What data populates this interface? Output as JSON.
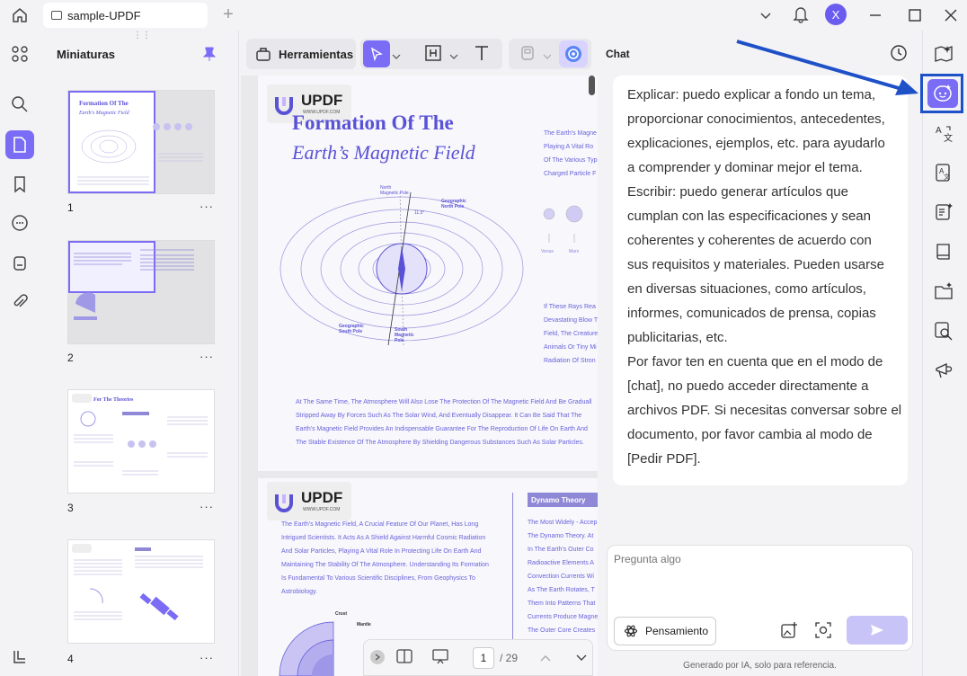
{
  "window": {
    "tab_title": "sample-UPDF",
    "avatar_letter": "X"
  },
  "sidebar": {
    "title": "Miniaturas",
    "pages": [
      "1",
      "2",
      "3",
      "4"
    ],
    "more_label": "···"
  },
  "toolbar": {
    "tools_label": "Herramientas"
  },
  "document": {
    "logo_text": "UPDF",
    "logo_sub": "WWW.UPDF.COM",
    "title_line1": "Formation Of The",
    "title_line2": "Earth’s Magnetic Field",
    "diagram_labels": {
      "north": "North\nMagnetic Pole",
      "geo_north": "Geographic\nNorth Pole",
      "geo_south": "Geographic\nSouth Pole",
      "south": "South\nMagnetic\nPole",
      "angle": "11.5°",
      "venus": "Venus",
      "mars": "Mars"
    },
    "side_text_1": "The Earth's Magne\nPlaying A Vital Ro\nOf The Various Typ\nCharged Particle F",
    "side_text_2": "If These Rays Rea\nDevastating Blow T\nField, The Creature\nAnimals Or Tiny Mi\nRadiation Of Stron",
    "body_text": "At The Same Time, The Atmosphere Will Also Lose The Protection Of The Magnetic Field And Be Graduall\nStripped Away By Forces Such As The Solar Wind, And Eventually Disappear. It Can Be Said That The\nEarth's Magnetic Field Provides An Indispensable Guarantee For The Reproduction Of Life On Earth And\nThe Stable Existence Of The Atmosphere By Shielding Dangerous Substances Such As Solar Particles.",
    "page2_text": "The Earth's Magnetic Field, A Crucial Feature Of Our Planet, Has Long\nIntrigued Scientists. It Acts As A Shield Against Harmful Cosmic Radiation\nAnd Solar Particles, Playing A Vital Role In Protecting Life On Earth And\nMaintaining The Stability Of The Atmosphere. Understanding Its Formation\nIs Fundamental To Various Scientific Disciplines, From Geophysics To\nAstrobiology.",
    "dynamo_title": "Dynamo Theory",
    "dynamo_text": "The Most Widely - Accep\nThe Dynamo Theory. At\nIn The Earth's Outer Co\nRadioactive Elements A\nConvection Currents Wi\nAs The Earth Rotates, T\nThem Into Patterns That\nCurrents Produce Magne\nThe Outer Core Creates",
    "crust_label": "Crust",
    "mantle_label": "Mantle",
    "page_current": "1",
    "page_total": "/ 29"
  },
  "chat": {
    "header": "Chat",
    "message": "Explicar: puedo explicar a fondo un tema,\nproporcionar conocimientos, antecedentes,\nexplicaciones, ejemplos, etc. para ayudarlo\na comprender y dominar mejor el tema.\nEscribir: puedo generar artículos que\ncumplan con las especificaciones y sean\ncoherentes y coherentes de acuerdo con\nsus requisitos y materiales. Pueden usarse\nen diversas situaciones, como artículos,\ninformes, comunicados de prensa, copias\npublicitarias, etc.\nPor favor ten en cuenta que en el modo de\n[chat], no puedo acceder directamente a\narchivos PDF. Si necesitas conversar sobre el\ndocumento, por favor cambia al modo de\n[Pedir PDF].",
    "input_placeholder": "Pregunta algo",
    "thinking_label": "Pensamiento",
    "footer": "Generado por IA, solo para referencia."
  },
  "colors": {
    "accent": "#7b6cf6",
    "highlight_box": "#1e50c8",
    "doc_text": "#5a52d5"
  }
}
